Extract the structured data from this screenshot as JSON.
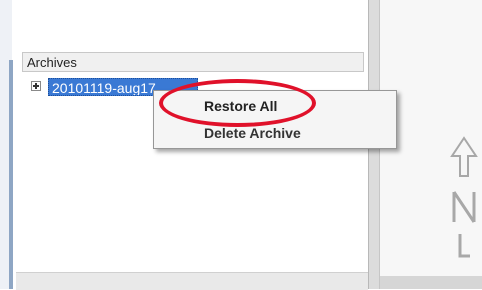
{
  "tree": {
    "section_header": "Archives",
    "items": [
      {
        "label": "20101119-aug17",
        "selected": true,
        "expanded": false
      }
    ]
  },
  "context_menu": {
    "items": [
      {
        "label": "Restore All",
        "highlighted": true
      },
      {
        "label": "Delete Archive"
      }
    ]
  },
  "annotation": {
    "color": "#e0112a"
  },
  "colors": {
    "selection": "#3a79d4",
    "menu_background": "#f5f5f5"
  },
  "icons": {
    "expander": "plus-box-icon",
    "compass": "north-arrow-icon"
  }
}
